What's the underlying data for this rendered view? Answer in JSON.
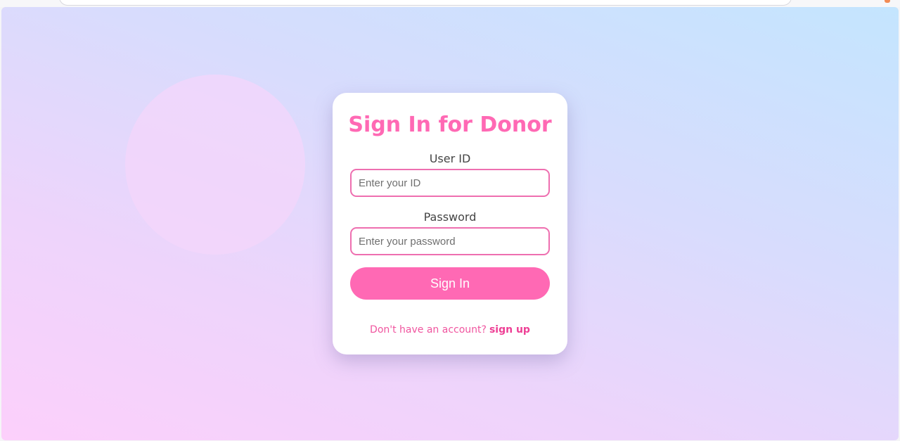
{
  "colors": {
    "accent": "#ff69b4",
    "input_border": "#ee6fb0",
    "link": "#ee3f95",
    "card_bg": "#ffffff"
  },
  "login_form": {
    "title": "Sign In for Donor",
    "user_id": {
      "label": "User ID",
      "placeholder": "Enter your ID",
      "value": ""
    },
    "password": {
      "label": "Password",
      "placeholder": "Enter your password",
      "value": ""
    },
    "submit_label": "Sign In",
    "signup_prompt": "Don't have an account?",
    "signup_link": "sign up"
  }
}
